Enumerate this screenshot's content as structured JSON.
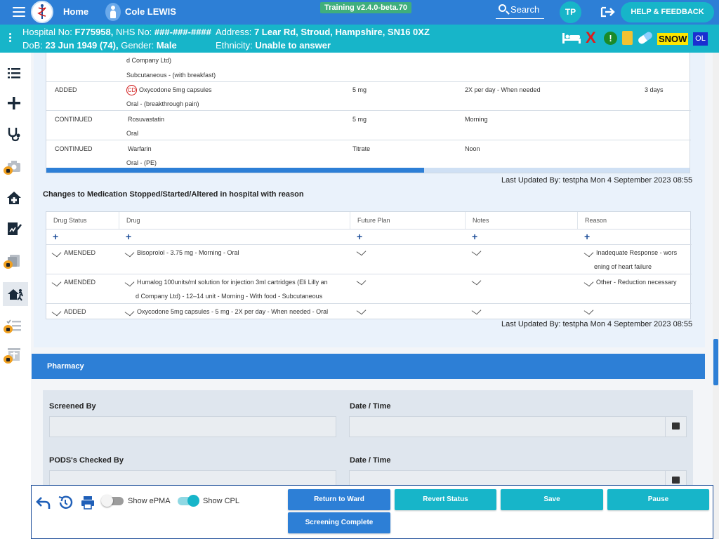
{
  "topbar": {
    "home_label": "Home",
    "patient_name": "Cole LEWIS",
    "build_label": "Training v2.4.0-beta.70",
    "search_label": "Search",
    "user_initials": "TP",
    "help_label": "HELP & FEEDBACK"
  },
  "banner": {
    "hospital_no_label": "Hospital No:",
    "hospital_no": "F775958,",
    "nhs_no_label": "NHS No:",
    "nhs_no": "###-###-####",
    "address_label": "Address:",
    "address": "7 Lear Rd, Stroud, Hampshire, SN16 0XZ",
    "dob_label": "DoB:",
    "dob": "23 Jun 1949 (74),",
    "gender_label": "Gender:",
    "gender": "Male",
    "ethnicity_label": "Ethnicity:",
    "ethnicity": "Unable to answer",
    "x_flag": "X",
    "alert_flag": "!",
    "snow_badge": "SNOW",
    "ol_badge": "OL"
  },
  "discharge_meds": {
    "partial_top": [
      "d Company Ltd)",
      "Subcutaneous - (with breakfast)"
    ],
    "rows": [
      {
        "status": "ADDED",
        "cd_badge": "CD",
        "drug": "Oxycodone 5mg capsules",
        "route": "Oral - (breakthrough pain)",
        "dose": "5 mg",
        "frequency": "2X per day - When needed",
        "duration": "3 days"
      },
      {
        "status": "CONTINUED",
        "drug": "Rosuvastatin",
        "route": "Oral",
        "dose": "5 mg",
        "frequency": "Morning",
        "duration": ""
      },
      {
        "status": "CONTINUED",
        "drug": "Warfarin",
        "route": "Oral - (PE)",
        "dose": "Titrate",
        "frequency": "Noon",
        "duration": ""
      }
    ],
    "last_updated": "Last Updated By: testpha Mon 4 September 2023 08:55"
  },
  "changes": {
    "title": "Changes to Medication Stopped/Started/Altered in hospital with reason",
    "headers": [
      "Drug Status",
      "Drug",
      "Future Plan",
      "Notes",
      "Reason"
    ],
    "plus_symbol": "+",
    "rows": [
      {
        "status": "AMENDED",
        "drug_line1": "Bisoprolol - 3.75 mg - Morning - Oral",
        "drug_line2": "",
        "reason_line1": "Inadequate Response - wors",
        "reason_line2": "ening of heart failure"
      },
      {
        "status": "AMENDED",
        "drug_line1": "Humalog 100units/ml solution for injection 3ml cartridges (Eli Lilly an",
        "drug_line2": "d Company Ltd) - 12–14 unit - Morning - With food - Subcutaneous",
        "reason_line1": "Other - Reduction necessary",
        "reason_line2": ""
      },
      {
        "status": "ADDED",
        "drug_line1": "Oxycodone 5mg capsules - 5 mg - 2X per day - When needed - Oral",
        "drug_line2": "",
        "reason_line1": "",
        "reason_line2": ""
      }
    ],
    "last_updated": "Last Updated By: testpha Mon 4 September 2023 08:55"
  },
  "pharmacy": {
    "title": "Pharmacy",
    "screened_by_label": "Screened By",
    "date_time_label": "Date / Time",
    "pods_checked_label": "PODS's Checked By",
    "date_time_label_2": "Date / Time"
  },
  "footer": {
    "show_epma_label": "Show ePMA",
    "show_epma_on": false,
    "show_cpl_label": "Show CPL",
    "show_cpl_on": true,
    "buttons": {
      "return_to_ward": "Return to Ward",
      "revert_status": "Revert Status",
      "save": "Save",
      "pause": "Pause",
      "screening_complete": "Screening Complete"
    }
  },
  "colors": {
    "primary_blue": "#2d7fd6",
    "teal": "#17b5c9",
    "lock_orange": "#f0a020",
    "cd_red": "#d01717"
  }
}
